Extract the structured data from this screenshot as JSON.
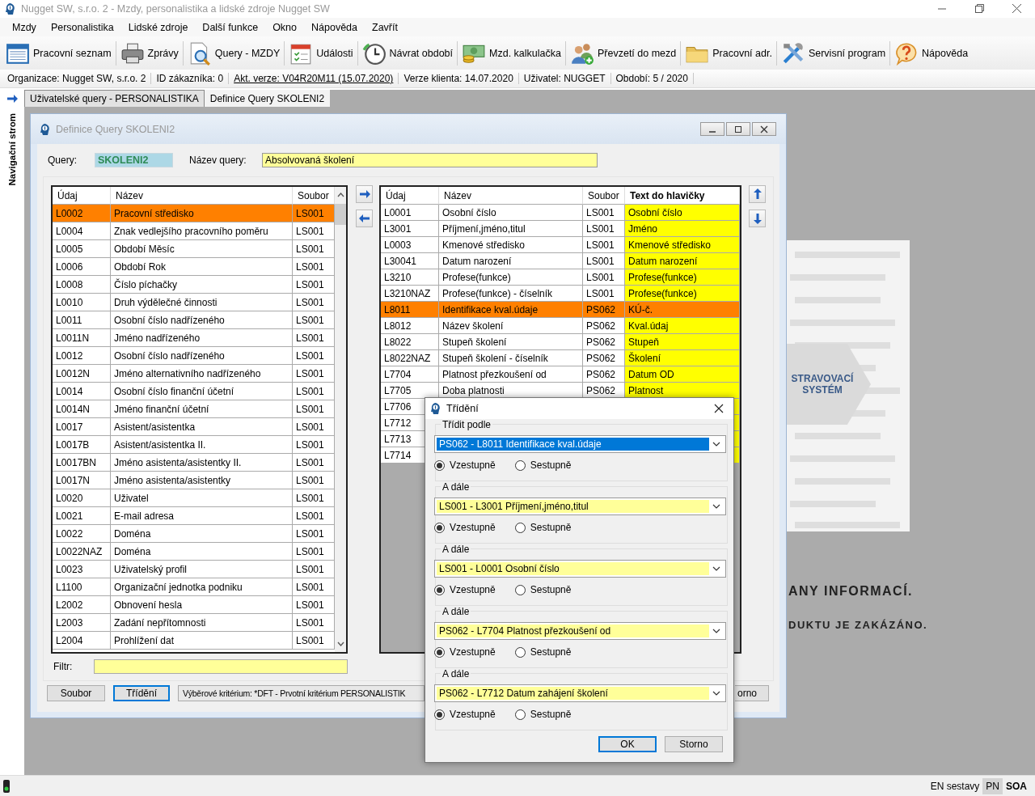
{
  "window": {
    "title": "Nugget SW, s.r.o. 2 - Mzdy, personalistika a lidské zdroje Nugget SW"
  },
  "menu": [
    "Mzdy",
    "Personalistika",
    "Lidské zdroje",
    "Další funkce",
    "Okno",
    "Nápověda",
    "Zavřít"
  ],
  "toolbar": [
    {
      "label": "Pracovní seznam",
      "kind": "list"
    },
    {
      "label": "Zprávy",
      "kind": "printer"
    },
    {
      "label": "Query - MZDY",
      "kind": "query"
    },
    {
      "label": "Události",
      "kind": "calendar"
    },
    {
      "label": "Návrat období",
      "kind": "clock"
    },
    {
      "label": "Mzd. kalkulačka",
      "kind": "money"
    },
    {
      "label": "Převzetí do mezd",
      "kind": "users"
    },
    {
      "label": "Pracovní adr.",
      "kind": "folder"
    },
    {
      "label": "Servisní program",
      "kind": "tools"
    },
    {
      "label": "Nápověda",
      "kind": "help"
    }
  ],
  "info_bar": [
    {
      "text": "Organizace: Nugget SW, s.r.o. 2",
      "link": false
    },
    {
      "text": "ID zákazníka: 0",
      "link": false
    },
    {
      "text": "Akt. verze: V04R20M11 (15.07.2020)",
      "link": true
    },
    {
      "text": "Verze klienta: 14.07.2020",
      "link": false
    },
    {
      "text": "Uživatel: NUGGET",
      "link": false
    },
    {
      "text": "Období: 5 / 2020",
      "link": false
    }
  ],
  "tabs": [
    {
      "label": "Uživatelské query - PERSONALISTIKA",
      "selected": false
    },
    {
      "label": "Definice Query SKOLENI2",
      "selected": true
    }
  ],
  "navigation": {
    "label": "Navigační strom"
  },
  "query_window": {
    "title": "Definice Query SKOLENI2",
    "query_label": "Query:",
    "query_value": "SKOLENI2",
    "name_label": "Název query:",
    "name_value": "Absolvovaná školení",
    "available": {
      "columns": [
        {
          "label": "Údaj",
          "editable": false
        },
        {
          "label": "Název",
          "editable": false
        },
        {
          "label": "Soubor",
          "editable": false
        }
      ],
      "rows": [
        {
          "cells": [
            "L0002",
            "Pracovní středisko",
            "LS001"
          ],
          "selected": true
        },
        {
          "cells": [
            "L0004",
            "Znak vedlejšího pracovního poměru",
            "LS001"
          ],
          "selected": false
        },
        {
          "cells": [
            "L0005",
            "Období Měsíc",
            "LS001"
          ],
          "selected": false
        },
        {
          "cells": [
            "L0006",
            "Období Rok",
            "LS001"
          ],
          "selected": false
        },
        {
          "cells": [
            "L0008",
            "Číslo píchačky",
            "LS001"
          ],
          "selected": false
        },
        {
          "cells": [
            "L0010",
            "Druh výdělečné činnosti",
            "LS001"
          ],
          "selected": false
        },
        {
          "cells": [
            "L0011",
            "Osobní číslo nadřízeného",
            "LS001"
          ],
          "selected": false
        },
        {
          "cells": [
            "L0011N",
            "Jméno nadřízeného",
            "LS001"
          ],
          "selected": false
        },
        {
          "cells": [
            "L0012",
            "Osobní číslo nadřízeného",
            "LS001"
          ],
          "selected": false
        },
        {
          "cells": [
            "L0012N",
            "Jméno alternativního nadřízeného",
            "LS001"
          ],
          "selected": false
        },
        {
          "cells": [
            "L0014",
            "Osobní číslo finanční účetní",
            "LS001"
          ],
          "selected": false
        },
        {
          "cells": [
            "L0014N",
            "Jméno finanční účetní",
            "LS001"
          ],
          "selected": false
        },
        {
          "cells": [
            "L0017",
            "Asistent/asistentka",
            "LS001"
          ],
          "selected": false
        },
        {
          "cells": [
            "L0017B",
            "Asistent/asistentka II.",
            "LS001"
          ],
          "selected": false
        },
        {
          "cells": [
            "L0017BN",
            "Jméno asistenta/asistentky II.",
            "LS001"
          ],
          "selected": false
        },
        {
          "cells": [
            "L0017N",
            "Jméno asistenta/asistentky",
            "LS001"
          ],
          "selected": false
        },
        {
          "cells": [
            "L0020",
            "Uživatel",
            "LS001"
          ],
          "selected": false
        },
        {
          "cells": [
            "L0021",
            "E-mail adresa",
            "LS001"
          ],
          "selected": false
        },
        {
          "cells": [
            "L0022",
            "Doména",
            "LS001"
          ],
          "selected": false
        },
        {
          "cells": [
            "L0022NAZ",
            "Doména",
            "LS001"
          ],
          "selected": false
        },
        {
          "cells": [
            "L0023",
            "Uživatelský profil",
            "LS001"
          ],
          "selected": false
        },
        {
          "cells": [
            "L1100",
            "Organizační jednotka podniku",
            "LS001"
          ],
          "selected": false
        },
        {
          "cells": [
            "L2002",
            "Obnovení hesla",
            "LS001"
          ],
          "selected": false
        },
        {
          "cells": [
            "L2003",
            "Zadání nepřítomnosti",
            "LS001"
          ],
          "selected": false
        },
        {
          "cells": [
            "L2004",
            "Prohlížení dat",
            "LS001"
          ],
          "selected": false
        }
      ]
    },
    "chosen": {
      "columns": [
        {
          "label": "Údaj",
          "editable": false
        },
        {
          "label": "Název",
          "editable": false
        },
        {
          "label": "Soubor",
          "editable": false
        },
        {
          "label": "Text do hlavičky",
          "editable": true
        }
      ],
      "rows": [
        {
          "cells": [
            "L0001",
            "Osobní číslo",
            "LS001",
            "Osobní číslo"
          ],
          "selected": false
        },
        {
          "cells": [
            "L3001",
            "Příjmení,jméno,titul",
            "LS001",
            "Jméno"
          ],
          "selected": false
        },
        {
          "cells": [
            "L0003",
            "Kmenové středisko",
            "LS001",
            "Kmenové středisko"
          ],
          "selected": false
        },
        {
          "cells": [
            "L30041",
            "Datum narození",
            "LS001",
            "Datum narození"
          ],
          "selected": false
        },
        {
          "cells": [
            "L3210",
            "Profese(funkce)",
            "LS001",
            "Profese(funkce)"
          ],
          "selected": false
        },
        {
          "cells": [
            "L3210NAZ",
            "Profese(funkce) - číselník",
            "LS001",
            "Profese(funkce)"
          ],
          "selected": false
        },
        {
          "cells": [
            "L8011",
            "Identifikace kval.údaje",
            "PS062",
            "KÚ-č."
          ],
          "selected": true
        },
        {
          "cells": [
            "L8012",
            "Název školení",
            "PS062",
            "Kval.údaj"
          ],
          "selected": false
        },
        {
          "cells": [
            "L8022",
            "Stupeň školení",
            "PS062",
            "Stupeň"
          ],
          "selected": false
        },
        {
          "cells": [
            "L8022NAZ",
            "Stupeň školení - číselník",
            "PS062",
            "Školení"
          ],
          "selected": false
        },
        {
          "cells": [
            "L7704",
            "Platnost přezkoušení od",
            "PS062",
            "Datum OD"
          ],
          "selected": false
        },
        {
          "cells": [
            "L7705",
            "Doba platnosti",
            "PS062",
            "Platnost"
          ],
          "selected": false
        },
        {
          "cells": [
            "L7706"
          ],
          "selected": false
        },
        {
          "cells": [
            "L7712"
          ],
          "selected": false
        },
        {
          "cells": [
            "L7713"
          ],
          "selected": false
        },
        {
          "cells": [
            "L7714"
          ],
          "selected": false
        }
      ]
    },
    "filter_label": "Filtr:",
    "buttons": [
      {
        "label": "Soubor",
        "focused": false
      },
      {
        "label": "Třídění",
        "focused": true
      }
    ],
    "criterion": "Výběrové kritérium: *DFT - Prvotní kritérium  PERSONALISTIK",
    "cut_button": "orno"
  },
  "sort_dialog": {
    "title": "Třídění",
    "groups": [
      {
        "label": "Třídit podle",
        "value": "PS062 - L8011 Identifikace kval.údaje",
        "highlighted": true,
        "options": [
          {
            "label": "Vzestupně",
            "selected": true
          },
          {
            "label": "Sestupně",
            "selected": false
          }
        ]
      },
      {
        "label": "A dále",
        "value": "LS001 - L3001 Příjmení,jméno,titul",
        "highlighted": false,
        "options": [
          {
            "label": "Vzestupně",
            "selected": true
          },
          {
            "label": "Sestupně",
            "selected": false
          }
        ]
      },
      {
        "label": "A dále",
        "value": "LS001 - L0001 Osobní číslo",
        "highlighted": false,
        "options": [
          {
            "label": "Vzestupně",
            "selected": true
          },
          {
            "label": "Sestupně",
            "selected": false
          }
        ]
      },
      {
        "label": "A dále",
        "value": "PS062 - L7704 Platnost přezkoušení od",
        "highlighted": false,
        "options": [
          {
            "label": "Vzestupně",
            "selected": true
          },
          {
            "label": "Sestupně",
            "selected": false
          }
        ]
      },
      {
        "label": "A dále",
        "value": "PS062 - L7712 Datum zahájení školení",
        "highlighted": false,
        "options": [
          {
            "label": "Vzestupně",
            "selected": true
          },
          {
            "label": "Sestupně",
            "selected": false
          }
        ]
      }
    ],
    "buttons": [
      {
        "label": "OK",
        "focused": true
      },
      {
        "label": "Storno",
        "focused": false
      }
    ]
  },
  "background": {
    "badge": "STRAVOVACÍ SYSTÉM",
    "lines": [
      "ANY INFORMACÍ.",
      "DUKTU JE ZAKÁZÁNO."
    ]
  },
  "status_bar": [
    {
      "text": "EN sestavy",
      "selected": false
    },
    {
      "text": "PN",
      "selected": true
    },
    {
      "text": "SOA",
      "selected": false
    }
  ]
}
